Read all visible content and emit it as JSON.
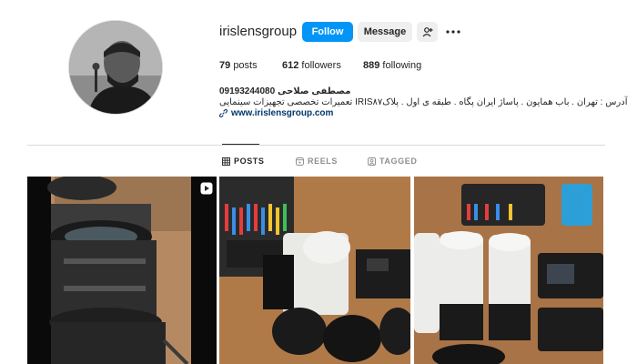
{
  "profile": {
    "username": "irislensgroup",
    "follow_label": "Follow",
    "message_label": "Message",
    "add_user_icon": "add-user-icon",
    "more_icon": "more-options-icon"
  },
  "stats": {
    "posts_count": "79",
    "posts_label": "posts",
    "followers_count": "612",
    "followers_label": "followers",
    "following_count": "889",
    "following_label": "following"
  },
  "bio": {
    "name": "09193244080 مصطفی صلاحی",
    "text": "تعمیرات تخصصی تجهیزات سینمایی IRISآدرس : تهران . باب همایون . پاساژ ایران پگاه . طبقه ی اول . پلاک۸۷",
    "link": "www.irislensgroup.com"
  },
  "tabs": [
    {
      "label": "POSTS",
      "icon": "grid-icon",
      "active": true
    },
    {
      "label": "REELS",
      "icon": "reels-icon",
      "active": false
    },
    {
      "label": "TAGGED",
      "icon": "tagged-icon",
      "active": false
    }
  ],
  "colors": {
    "accent": "#0095f6",
    "link": "#00376b",
    "muted": "#8e8e8e",
    "border": "#dbdbdb"
  }
}
